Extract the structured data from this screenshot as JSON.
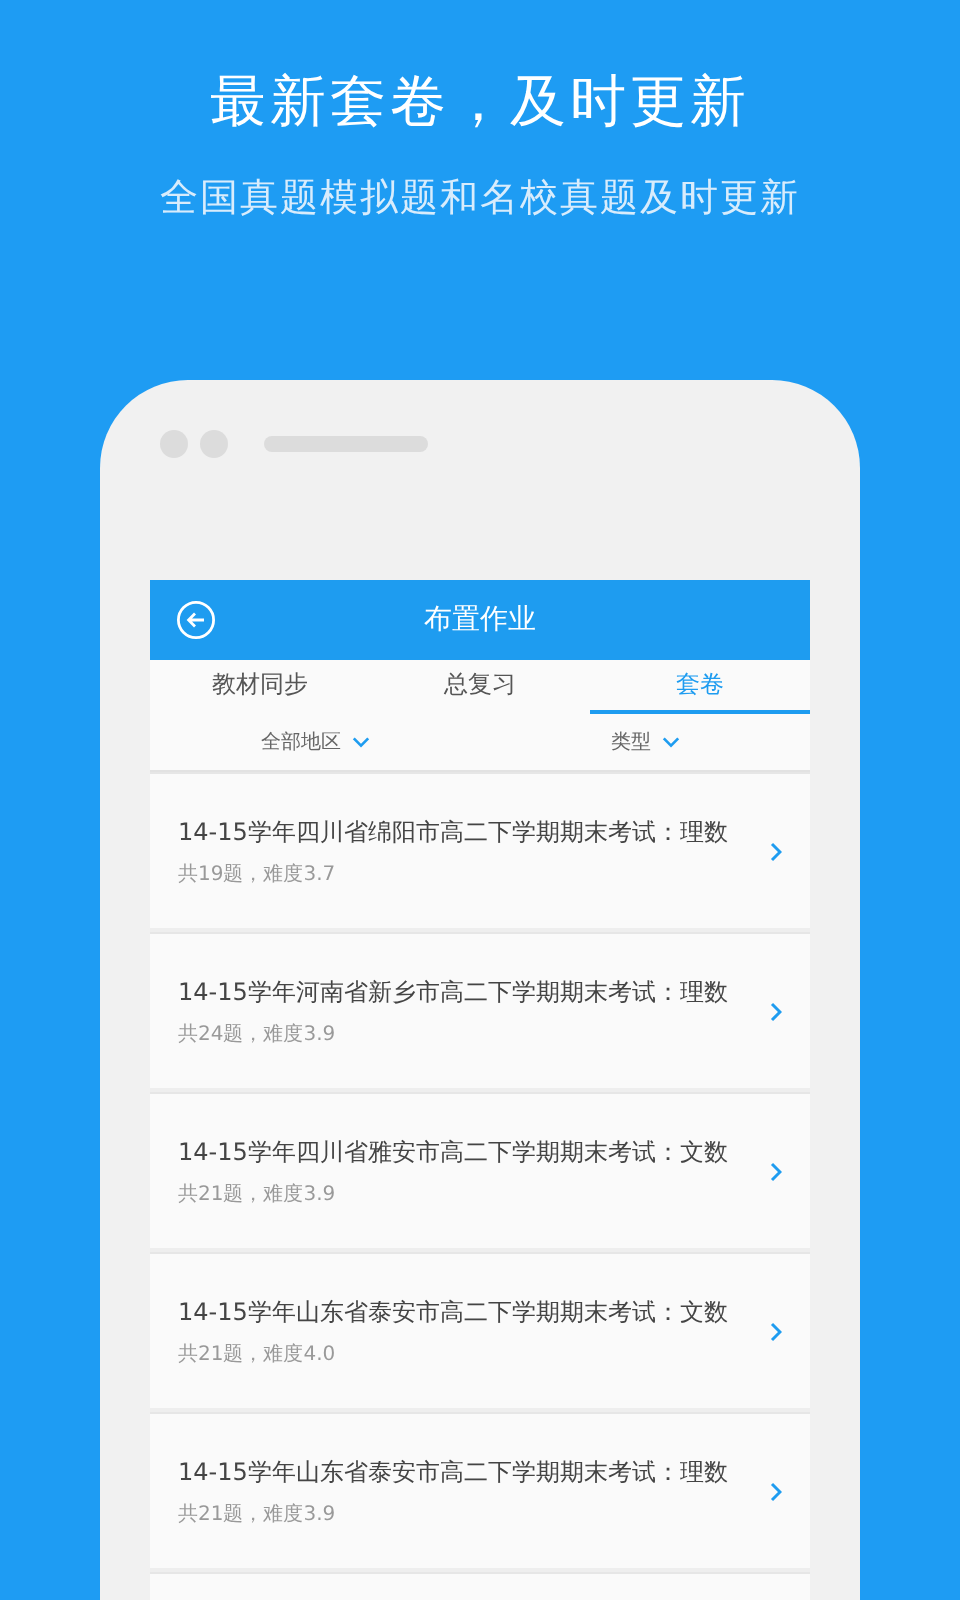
{
  "headline": "最新套卷，及时更新",
  "subheadline": "全国真题模拟题和名校真题及时更新",
  "app": {
    "title": "布置作业",
    "tabs": [
      {
        "label": "教材同步",
        "selected": false
      },
      {
        "label": "总复习",
        "selected": false
      },
      {
        "label": "套卷",
        "selected": true
      }
    ],
    "filters": [
      "全部地区",
      "类型"
    ],
    "papers": [
      {
        "title": "14-15学年四川省绵阳市高二下学期期末考试：理数",
        "meta": "共19题，难度3.7"
      },
      {
        "title": "14-15学年河南省新乡市高二下学期期末考试：理数",
        "meta": "共24题，难度3.9"
      },
      {
        "title": "14-15学年四川省雅安市高二下学期期末考试：文数",
        "meta": "共21题，难度3.9"
      },
      {
        "title": "14-15学年山东省泰安市高二下学期期末考试：文数",
        "meta": "共21题，难度4.0"
      },
      {
        "title": "14-15学年山东省泰安市高二下学期期末考试：理数",
        "meta": "共21题，难度3.9"
      }
    ]
  }
}
